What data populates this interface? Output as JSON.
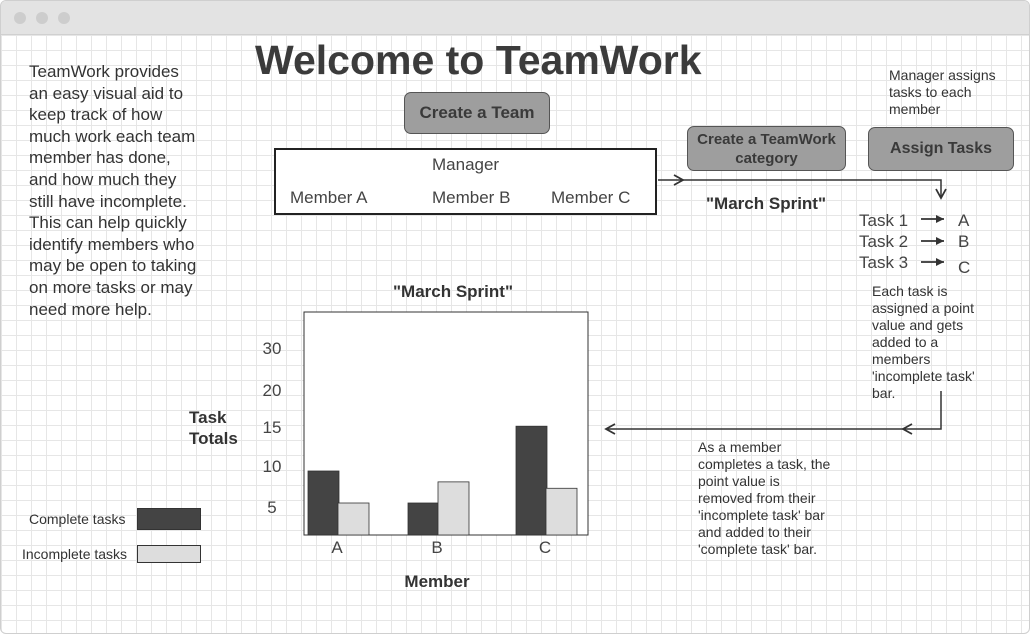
{
  "intro": {
    "lines": [
      "TeamWork provides",
      "an easy visual aid to",
      "keep track of how",
      "much work each team",
      "member has done,",
      "and how much they",
      "still have incomplete.",
      "This can help quickly",
      "identify members who",
      "may be open to taking",
      "on more tasks or may",
      "need more help."
    ]
  },
  "header": {
    "title": "Welcome to TeamWork"
  },
  "buttons": {
    "create_team": "Create a Team",
    "create_category_line1": "Create a TeamWork",
    "create_category_line2": "category",
    "assign_tasks": "Assign Tasks"
  },
  "team": {
    "manager": "Manager",
    "members": [
      "Member A",
      "Member B",
      "Member C"
    ]
  },
  "notes": {
    "manager_assigns": [
      "Manager assigns",
      "tasks to each",
      "member"
    ],
    "each_task": [
      "Each task is",
      "assigned a point",
      "value and gets",
      "added to a",
      "members",
      "'incomplete task'",
      "bar."
    ],
    "completes_task": [
      "As a member",
      "completes a task, the",
      "point value is",
      "removed from their",
      "'incomplete task' bar",
      "and added to their",
      "'complete task' bar."
    ]
  },
  "sprint_label": "\"March Sprint\"",
  "tasks": [
    {
      "task": "Task 1",
      "member": "A"
    },
    {
      "task": "Task 2",
      "member": "B"
    },
    {
      "task": "Task 3",
      "member": "C"
    }
  ],
  "legend": {
    "complete": "Complete tasks",
    "incomplete": "Incomplete tasks"
  },
  "colors": {
    "complete": "#444444",
    "incomplete": "#dddddd",
    "button": "#9e9e9e"
  },
  "chart_data": {
    "type": "bar",
    "title": "\"March Sprint\"",
    "xlabel": "Member",
    "ylabel_lines": [
      "Task",
      "Totals"
    ],
    "categories": [
      "A",
      "B",
      "C"
    ],
    "y_ticks": [
      5,
      10,
      15,
      20,
      30
    ],
    "ylim": [
      0,
      30
    ],
    "series": [
      {
        "name": "Complete tasks",
        "values": [
          10,
          5,
          17
        ]
      },
      {
        "name": "Incomplete tasks",
        "values": [
          5,
          8.3,
          7.3
        ]
      }
    ],
    "legend_position": "bottom-left",
    "grid": false
  }
}
